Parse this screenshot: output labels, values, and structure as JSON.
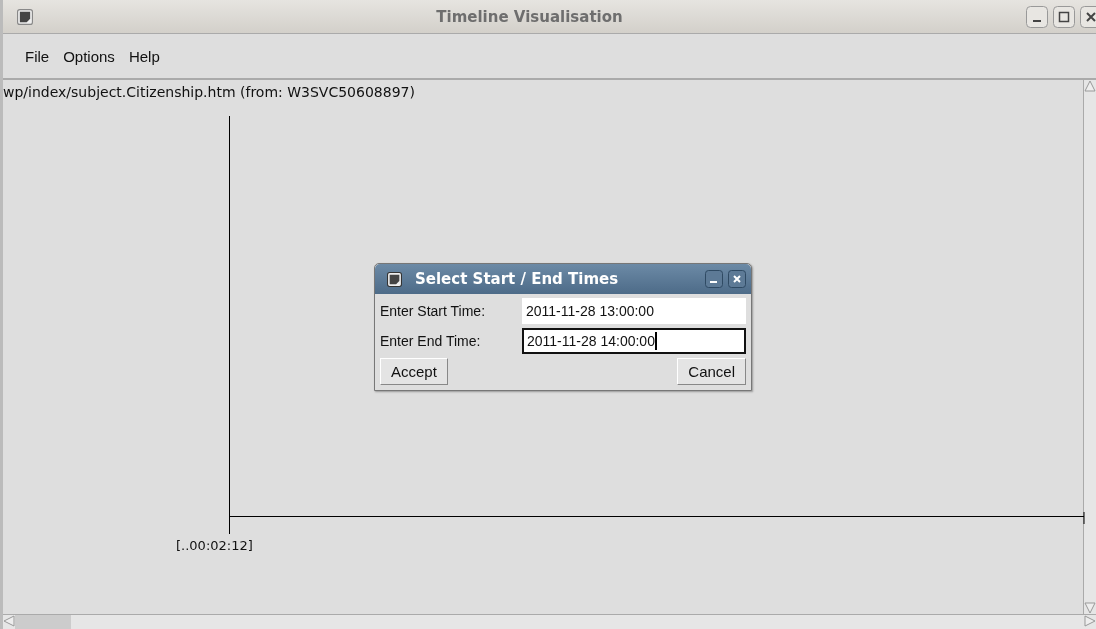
{
  "window": {
    "title": "Timeline Visualisation"
  },
  "menu": [
    "File",
    "Options",
    "Help"
  ],
  "timeline": {
    "source": "wp/index/subject.Citizenship.htm (from: W3SVC50608897)",
    "axis_label": "[..00:02:12]"
  },
  "dialog": {
    "title": "Select Start / End Times",
    "fields": [
      {
        "label": "Enter Start Time:",
        "value": "2011-11-28 13:00:00",
        "focused": false
      },
      {
        "label": "Enter End Time:",
        "value": "2011-11-28 14:00:00",
        "focused": true
      }
    ],
    "buttons": [
      "Accept",
      "Cancel"
    ]
  }
}
